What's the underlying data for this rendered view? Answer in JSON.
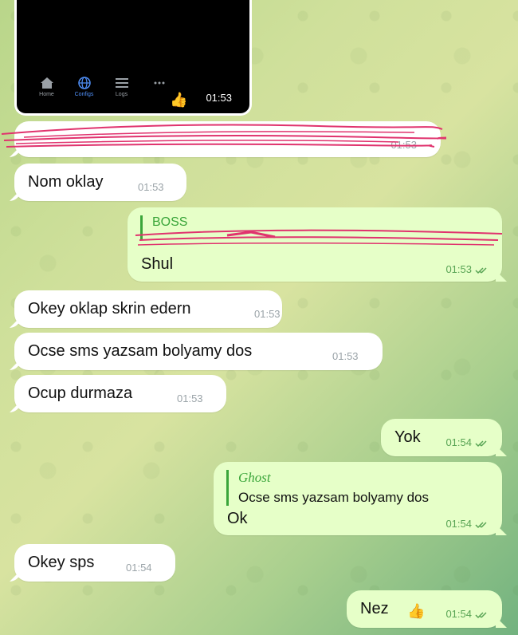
{
  "screenshot": {
    "nav": [
      {
        "label": "Home",
        "icon": "home-icon"
      },
      {
        "label": "Configs",
        "icon": "globe-icon"
      },
      {
        "label": "Logs",
        "icon": "list-icon"
      },
      {
        "label": "",
        "icon": "more-icon"
      }
    ],
    "emoji": "👍",
    "time": "01:53"
  },
  "messages": [
    {
      "id": "redacted",
      "direction": "in",
      "text": "",
      "time": "01:53",
      "redacted": true
    },
    {
      "id": "nom-oklay",
      "direction": "in",
      "text": "Nom oklay",
      "time": "01:53"
    },
    {
      "id": "shul",
      "direction": "out",
      "reply_author": "BOSS",
      "reply_text": "",
      "text": "Shul",
      "time": "01:53",
      "reply_redacted": true
    },
    {
      "id": "okey-oklap",
      "direction": "in",
      "text": "Okey oklap skrin edern",
      "time": "01:53"
    },
    {
      "id": "ocse-sms",
      "direction": "in",
      "text": "Ocse sms yazsam bolyamy dos",
      "time": "01:53"
    },
    {
      "id": "ocup",
      "direction": "in",
      "text": "Ocup durmaza",
      "time": "01:53"
    },
    {
      "id": "yok",
      "direction": "out",
      "text": "Yok",
      "time": "01:54"
    },
    {
      "id": "ok",
      "direction": "out",
      "reply_author": "Ghost",
      "reply_text": "Ocse sms yazsam bolyamy dos",
      "text": "Ok",
      "time": "01:54"
    },
    {
      "id": "okey-sps",
      "direction": "in",
      "text": "Okey sps",
      "time": "01:54"
    },
    {
      "id": "nez",
      "direction": "out",
      "text": "Nez",
      "emoji": "👍",
      "time": "01:54"
    }
  ],
  "colors": {
    "outgoing_bubble": "#e6ffc8",
    "incoming_bubble": "#ffffff",
    "reply_accent": "#3aa53a",
    "redaction": "#e0336e"
  }
}
